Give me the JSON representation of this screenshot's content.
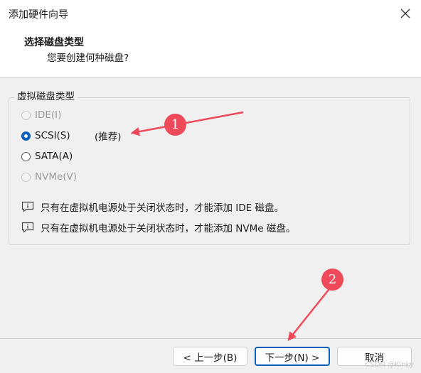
{
  "window": {
    "title": "添加硬件向导"
  },
  "header": {
    "title": "选择磁盘类型",
    "subtitle": "您要创建何种磁盘?"
  },
  "group": {
    "label": "虚拟磁盘类型"
  },
  "options": [
    {
      "label": "IDE(I)",
      "checked": false,
      "disabled": true
    },
    {
      "label": "SCSI(S)",
      "checked": true,
      "disabled": false
    },
    {
      "label": "SATA(A)",
      "checked": false,
      "disabled": false
    },
    {
      "label": "NVMe(V)",
      "checked": false,
      "disabled": true
    }
  ],
  "recommended": "(推荐)",
  "notes": [
    "只有在虚拟机电源处于关闭状态时，才能添加 IDE 磁盘。",
    "只有在虚拟机电源处于关闭状态时，才能添加 NVMe 磁盘。"
  ],
  "buttons": {
    "back": "< 上一步(B)",
    "next": "下一步(N) >",
    "cancel": "取消"
  },
  "annotations": {
    "badge1": "1",
    "badge2": "2",
    "color": "#ef4a5a"
  },
  "watermark": "CSDN @Kinky"
}
